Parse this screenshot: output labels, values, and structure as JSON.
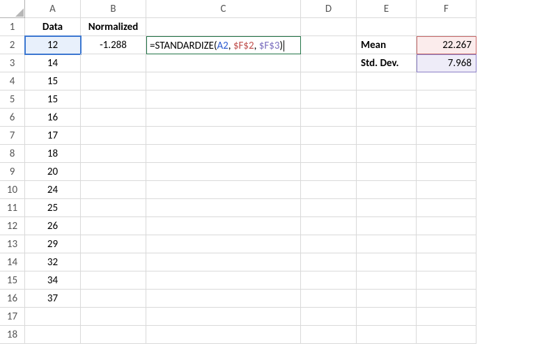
{
  "columns": [
    "A",
    "B",
    "C",
    "D",
    "E",
    "F"
  ],
  "rowCount": 18,
  "headers": {
    "A1": "Data",
    "B1": "Normalized"
  },
  "colA": [
    "12",
    "14",
    "15",
    "15",
    "16",
    "17",
    "18",
    "20",
    "24",
    "25",
    "26",
    "29",
    "32",
    "34",
    "37"
  ],
  "B2": "-1.288",
  "E2": "Mean",
  "E3": "Std. Dev.",
  "F2": "22.267",
  "F3": "7.968",
  "formula": {
    "prefix": "=STANDARDIZE(",
    "ref1": "A2",
    "sep1": ", ",
    "ref2": "$F$2",
    "sep2": ", ",
    "ref3": "$F$3",
    "suffix": ")"
  },
  "selection": {
    "active": "A2",
    "editing": "C2",
    "refHighlights": [
      "F2",
      "F3"
    ]
  }
}
